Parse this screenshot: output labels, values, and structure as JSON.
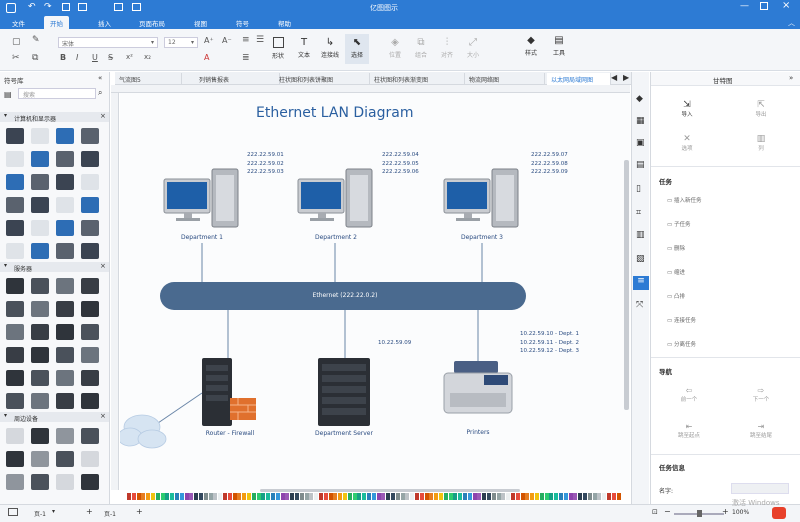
{
  "app": {
    "title": "亿图图示"
  },
  "menu": {
    "items": [
      "文件",
      "开始",
      "插入",
      "页面布局",
      "视图",
      "符号",
      "帮助"
    ],
    "active_index": 1
  },
  "ribbon": {
    "font_name": "宋体",
    "font_size": "12",
    "buttons": [
      "形状",
      "文本",
      "连接线",
      "选择",
      "位置",
      "组合",
      "对齐",
      "大小",
      "样式",
      "工具"
    ]
  },
  "doc_tabs": [
    "气流图5",
    "列销售报表",
    "柱状图和列表饼聚图",
    "柱状图和列表渐变图",
    "物流网络图",
    "以太网局域网图"
  ],
  "active_tab_index": 5,
  "left_panel": {
    "title": "符号库",
    "search_placeholder": "搜索",
    "sections": [
      "计算机和显示器",
      "服务器",
      "周边设备"
    ]
  },
  "diagram": {
    "title": "Ethernet LAN Diagram",
    "backbone_label": "Ethernet (222.22.0.2)",
    "departments": [
      {
        "label": "Department 1",
        "ips": [
          "222.22.59.01",
          "222.22.59.02",
          "222.22.59.03"
        ]
      },
      {
        "label": "Department 2",
        "ips": [
          "222.22.59.04",
          "222.22.59.05",
          "222.22.59.06"
        ]
      },
      {
        "label": "Department 3",
        "ips": [
          "222.22.59.07",
          "222.22.59.08",
          "222.22.59.09"
        ]
      }
    ],
    "router_label": "Router - Firewall",
    "server_label": "Department Server",
    "server_ip": "10.22.59.09",
    "printer_label": "Printers",
    "printer_ips": [
      "10.22.59.10 - Dept. 1",
      "10.22.59.11 - Dept. 2",
      "10.22.59.12 - Dept. 3"
    ]
  },
  "right_panel": {
    "title": "甘特图",
    "top_buttons": [
      "导入",
      "导出",
      "选项",
      "列"
    ],
    "task_heading": "任务",
    "task_items": [
      "插入新任务",
      "子任务",
      "删除",
      "缩进",
      "凸排",
      "连接任务",
      "分离任务"
    ],
    "nav_heading": "导航",
    "nav_buttons": [
      "前一个",
      "下一个",
      "跳至起点",
      "跳至结尾"
    ],
    "info_heading": "任务信息",
    "info_name_label": "名字:"
  },
  "status": {
    "page_left": "页-1",
    "page_tab": "页-1",
    "zoom": "100%",
    "watermark": "激活 Windows"
  },
  "colors": {
    "brand": "#2d7bd4",
    "backbone": "#4a6a8f",
    "text_blue": "#2a4b80"
  }
}
